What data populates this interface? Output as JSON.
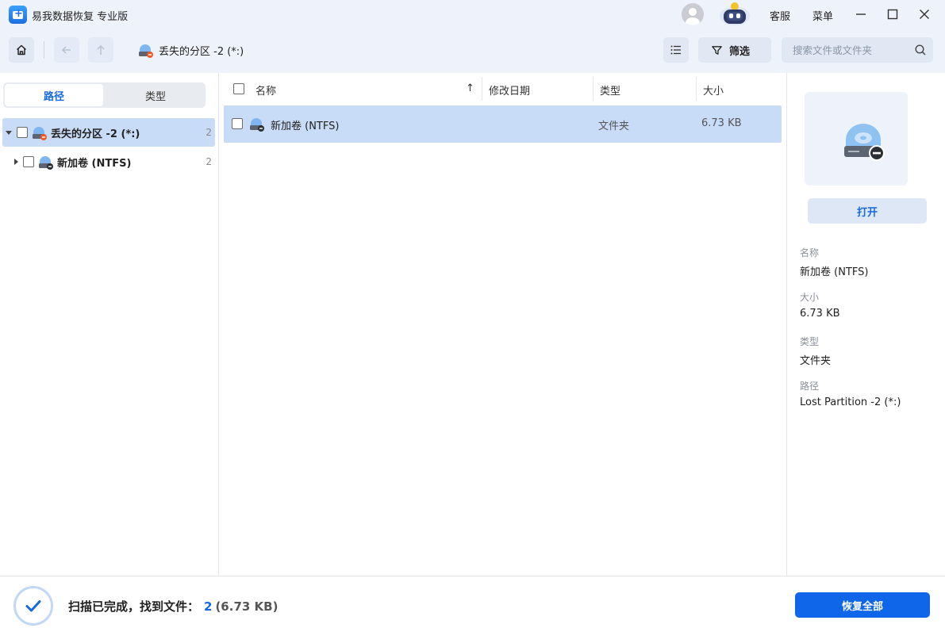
{
  "app": {
    "title": "易我数据恢复 专业版"
  },
  "titlebar": {
    "support_label": "客服",
    "menu_label": "菜单"
  },
  "toolbar": {
    "breadcrumb": "丢失的分区 -2 (*:)",
    "filter_label": "筛选",
    "search_placeholder": "搜索文件或文件夹"
  },
  "sidebar": {
    "tabs": [
      {
        "label": "路径",
        "active": true
      },
      {
        "label": "类型",
        "active": false
      }
    ],
    "tree": [
      {
        "label": "丢失的分区 -2 (*:)",
        "count": "2",
        "expanded": true,
        "selected": true
      },
      {
        "label": "新加卷 (NTFS)",
        "count": "2",
        "expanded": false,
        "selected": false
      }
    ]
  },
  "file_list": {
    "columns": {
      "name": "名称",
      "modified": "修改日期",
      "type": "类型",
      "size": "大小"
    },
    "sort_indicator": "↑",
    "rows": [
      {
        "name": "新加卷 (NTFS)",
        "modified": "",
        "type": "文件夹",
        "size": "6.73 KB",
        "selected": true
      }
    ]
  },
  "details": {
    "open_label": "打开",
    "name_label": "名称",
    "name_value": "新加卷 (NTFS)",
    "size_label": "大小",
    "size_value": "6.73 KB",
    "type_label": "类型",
    "type_value": "文件夹",
    "path_label": "路径",
    "path_value": "Lost Partition -2 (*:)"
  },
  "footer": {
    "status_text": "扫描已完成，找到文件：",
    "file_count": "2",
    "total_size": "(6.73 KB)",
    "recover_all_label": "恢复全部"
  },
  "colors": {
    "accent": "#1066e8",
    "selection": "#c9dcf7",
    "panel_bg": "#eef3fb"
  }
}
